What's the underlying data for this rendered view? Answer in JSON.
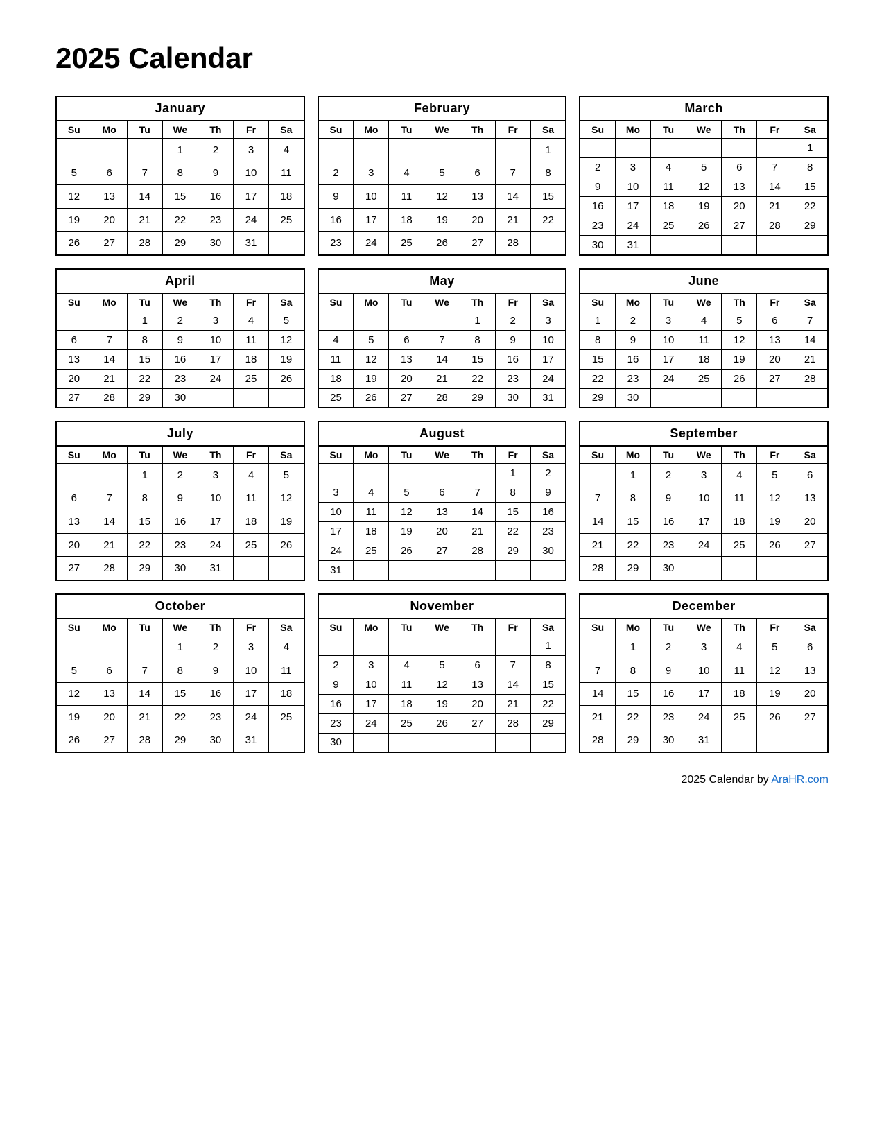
{
  "title": "2025 Calendar",
  "footer": {
    "text": "2025  Calendar by ",
    "link_text": "AraHR.com",
    "link_url": "#"
  },
  "days_header": [
    "Su",
    "Mo",
    "Tu",
    "We",
    "Th",
    "Fr",
    "Sa"
  ],
  "months": [
    {
      "name": "January",
      "weeks": [
        [
          "",
          "",
          "",
          "1",
          "2",
          "3",
          "4"
        ],
        [
          "5",
          "6",
          "7",
          "8",
          "9",
          "10",
          "11"
        ],
        [
          "12",
          "13",
          "14",
          "15",
          "16",
          "17",
          "18"
        ],
        [
          "19",
          "20",
          "21",
          "22",
          "23",
          "24",
          "25"
        ],
        [
          "26",
          "27",
          "28",
          "29",
          "30",
          "31",
          ""
        ]
      ]
    },
    {
      "name": "February",
      "weeks": [
        [
          "",
          "",
          "",
          "",
          "",
          "",
          "1"
        ],
        [
          "2",
          "3",
          "4",
          "5",
          "6",
          "7",
          "8"
        ],
        [
          "9",
          "10",
          "11",
          "12",
          "13",
          "14",
          "15"
        ],
        [
          "16",
          "17",
          "18",
          "19",
          "20",
          "21",
          "22"
        ],
        [
          "23",
          "24",
          "25",
          "26",
          "27",
          "28",
          ""
        ]
      ]
    },
    {
      "name": "March",
      "weeks": [
        [
          "",
          "",
          "",
          "",
          "",
          "",
          "1"
        ],
        [
          "2",
          "3",
          "4",
          "5",
          "6",
          "7",
          "8"
        ],
        [
          "9",
          "10",
          "11",
          "12",
          "13",
          "14",
          "15"
        ],
        [
          "16",
          "17",
          "18",
          "19",
          "20",
          "21",
          "22"
        ],
        [
          "23",
          "24",
          "25",
          "26",
          "27",
          "28",
          "29"
        ],
        [
          "30",
          "31",
          "",
          "",
          "",
          "",
          ""
        ]
      ]
    },
    {
      "name": "April",
      "weeks": [
        [
          "",
          "",
          "1",
          "2",
          "3",
          "4",
          "5"
        ],
        [
          "6",
          "7",
          "8",
          "9",
          "10",
          "11",
          "12"
        ],
        [
          "13",
          "14",
          "15",
          "16",
          "17",
          "18",
          "19"
        ],
        [
          "20",
          "21",
          "22",
          "23",
          "24",
          "25",
          "26"
        ],
        [
          "27",
          "28",
          "29",
          "30",
          "",
          "",
          ""
        ]
      ]
    },
    {
      "name": "May",
      "weeks": [
        [
          "",
          "",
          "",
          "",
          "1",
          "2",
          "3"
        ],
        [
          "4",
          "5",
          "6",
          "7",
          "8",
          "9",
          "10"
        ],
        [
          "11",
          "12",
          "13",
          "14",
          "15",
          "16",
          "17"
        ],
        [
          "18",
          "19",
          "20",
          "21",
          "22",
          "23",
          "24"
        ],
        [
          "25",
          "26",
          "27",
          "28",
          "29",
          "30",
          "31"
        ]
      ]
    },
    {
      "name": "June",
      "weeks": [
        [
          "1",
          "2",
          "3",
          "4",
          "5",
          "6",
          "7"
        ],
        [
          "8",
          "9",
          "10",
          "11",
          "12",
          "13",
          "14"
        ],
        [
          "15",
          "16",
          "17",
          "18",
          "19",
          "20",
          "21"
        ],
        [
          "22",
          "23",
          "24",
          "25",
          "26",
          "27",
          "28"
        ],
        [
          "29",
          "30",
          "",
          "",
          "",
          "",
          ""
        ]
      ]
    },
    {
      "name": "July",
      "weeks": [
        [
          "",
          "",
          "1",
          "2",
          "3",
          "4",
          "5"
        ],
        [
          "6",
          "7",
          "8",
          "9",
          "10",
          "11",
          "12"
        ],
        [
          "13",
          "14",
          "15",
          "16",
          "17",
          "18",
          "19"
        ],
        [
          "20",
          "21",
          "22",
          "23",
          "24",
          "25",
          "26"
        ],
        [
          "27",
          "28",
          "29",
          "30",
          "31",
          "",
          ""
        ]
      ]
    },
    {
      "name": "August",
      "weeks": [
        [
          "",
          "",
          "",
          "",
          "",
          "1",
          "2"
        ],
        [
          "3",
          "4",
          "5",
          "6",
          "7",
          "8",
          "9"
        ],
        [
          "10",
          "11",
          "12",
          "13",
          "14",
          "15",
          "16"
        ],
        [
          "17",
          "18",
          "19",
          "20",
          "21",
          "22",
          "23"
        ],
        [
          "24",
          "25",
          "26",
          "27",
          "28",
          "29",
          "30"
        ],
        [
          "31",
          "",
          "",
          "",
          "",
          "",
          ""
        ]
      ]
    },
    {
      "name": "September",
      "weeks": [
        [
          "",
          "1",
          "2",
          "3",
          "4",
          "5",
          "6"
        ],
        [
          "7",
          "8",
          "9",
          "10",
          "11",
          "12",
          "13"
        ],
        [
          "14",
          "15",
          "16",
          "17",
          "18",
          "19",
          "20"
        ],
        [
          "21",
          "22",
          "23",
          "24",
          "25",
          "26",
          "27"
        ],
        [
          "28",
          "29",
          "30",
          "",
          "",
          "",
          ""
        ]
      ]
    },
    {
      "name": "October",
      "weeks": [
        [
          "",
          "",
          "",
          "1",
          "2",
          "3",
          "4"
        ],
        [
          "5",
          "6",
          "7",
          "8",
          "9",
          "10",
          "11"
        ],
        [
          "12",
          "13",
          "14",
          "15",
          "16",
          "17",
          "18"
        ],
        [
          "19",
          "20",
          "21",
          "22",
          "23",
          "24",
          "25"
        ],
        [
          "26",
          "27",
          "28",
          "29",
          "30",
          "31",
          ""
        ]
      ]
    },
    {
      "name": "November",
      "weeks": [
        [
          "",
          "",
          "",
          "",
          "",
          "",
          "1"
        ],
        [
          "2",
          "3",
          "4",
          "5",
          "6",
          "7",
          "8"
        ],
        [
          "9",
          "10",
          "11",
          "12",
          "13",
          "14",
          "15"
        ],
        [
          "16",
          "17",
          "18",
          "19",
          "20",
          "21",
          "22"
        ],
        [
          "23",
          "24",
          "25",
          "26",
          "27",
          "28",
          "29"
        ],
        [
          "30",
          "",
          "",
          "",
          "",
          "",
          ""
        ]
      ]
    },
    {
      "name": "December",
      "weeks": [
        [
          "",
          "1",
          "2",
          "3",
          "4",
          "5",
          "6"
        ],
        [
          "7",
          "8",
          "9",
          "10",
          "11",
          "12",
          "13"
        ],
        [
          "14",
          "15",
          "16",
          "17",
          "18",
          "19",
          "20"
        ],
        [
          "21",
          "22",
          "23",
          "24",
          "25",
          "26",
          "27"
        ],
        [
          "28",
          "29",
          "30",
          "31",
          "",
          "",
          ""
        ]
      ]
    }
  ]
}
